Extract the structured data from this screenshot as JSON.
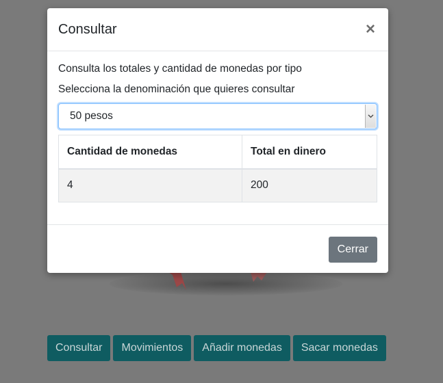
{
  "modal": {
    "title": "Consultar",
    "close_symbol": "×",
    "intro": "Consulta los totales y cantidad de monedas por tipo",
    "select_label": "Selecciona la denominación que quieres consultar",
    "select": {
      "selected_value": "50 pesos",
      "arrow_icon": "chevron-down-icon"
    },
    "table": {
      "headers": [
        "Cantidad de monedas",
        "Total en dinero"
      ],
      "rows": [
        [
          "4",
          "200"
        ]
      ]
    },
    "footer_button": "Cerrar"
  },
  "actions": [
    "Consultar",
    "Movimientos",
    "Añadir monedas",
    "Sacar monedas"
  ],
  "colors": {
    "overlay_bg": "#7a7a7a",
    "action_button_bg": "#0f5c61",
    "secondary_button_bg": "#6c757d",
    "focus_border": "#80bdff",
    "deco_red": "#b04a4a"
  }
}
